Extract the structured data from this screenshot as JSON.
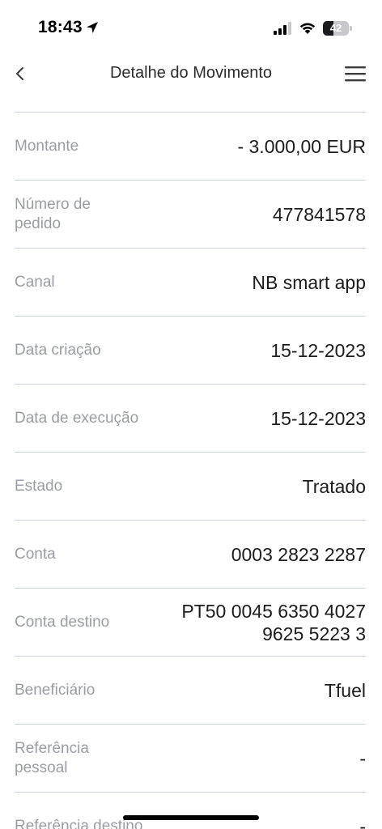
{
  "status_bar": {
    "time": "18:43",
    "battery_level": "42",
    "battery_percent": 42
  },
  "nav": {
    "title": "Detalhe do Movimento"
  },
  "details": [
    {
      "label": "Montante",
      "value": "- 3.000,00 EUR"
    },
    {
      "label": "Número de pedido",
      "value": "477841578"
    },
    {
      "label": "Canal",
      "value": "NB smart app"
    },
    {
      "label": "Data criação",
      "value": "15-12-2023"
    },
    {
      "label": "Data de execução",
      "value": "15-12-2023"
    },
    {
      "label": "Estado",
      "value": "Tratado"
    },
    {
      "label": "Conta",
      "value": "0003 2823 2287"
    },
    {
      "label": "Conta destino",
      "value": "PT50 0045 6350 4027 9625 5223 3"
    },
    {
      "label": "Beneficiário",
      "value": "Tfuel"
    },
    {
      "label": "Referência pessoal",
      "value": "-"
    },
    {
      "label": "Referência destino",
      "value": "-"
    }
  ]
}
